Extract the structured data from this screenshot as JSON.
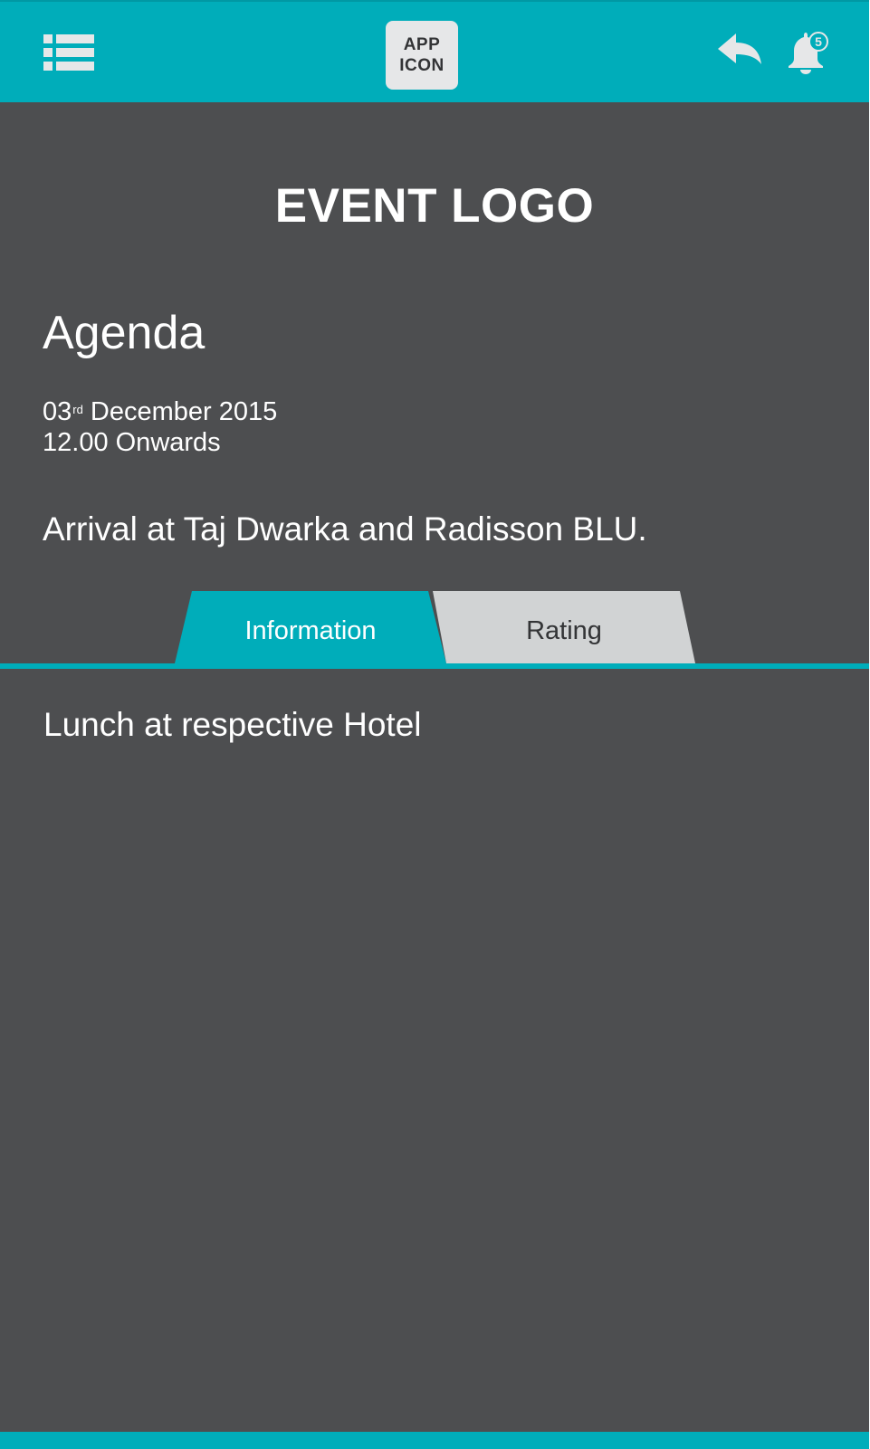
{
  "colors": {
    "accent": "#00adba",
    "background": "#4d4e50",
    "icon_light": "#e6e7e8",
    "tab_inactive": "#d1d3d4",
    "text_light": "#ffffff",
    "text_dark": "#333436"
  },
  "header": {
    "menu_icon": "list-menu-icon",
    "app_icon": {
      "line1": "APP",
      "line2": "ICON"
    },
    "back_icon": "reply-arrow-icon",
    "notification_icon": "bell-icon",
    "notification_count": "5"
  },
  "event_logo": "EVENT LOGO",
  "agenda": {
    "title": "Agenda",
    "date_day": "03",
    "date_suffix": "rd",
    "date_rest": " December 2015",
    "time": "12.00 Onwards",
    "subtitle": "Arrival at Taj Dwarka and Radisson BLU."
  },
  "tabs": [
    {
      "label": "Information",
      "active": true
    },
    {
      "label": "Rating",
      "active": false
    }
  ],
  "tab_content": {
    "text": "Lunch at respective Hotel"
  }
}
